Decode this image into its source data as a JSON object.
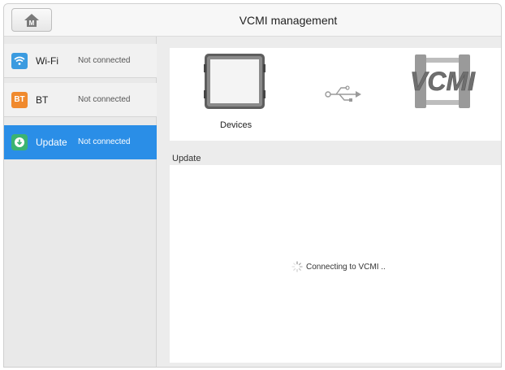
{
  "header": {
    "title": "VCMI management",
    "home_icon": "home-icon",
    "home_label": "M"
  },
  "sidebar": {
    "items": [
      {
        "icon": "wifi-icon",
        "icon_color": "#3b9be0",
        "label": "Wi-Fi",
        "status": "Not connected",
        "active": false
      },
      {
        "icon": "bt-icon",
        "icon_text": "BT",
        "icon_color": "#f08a2e",
        "label": "BT",
        "status": "Not connected",
        "active": false
      },
      {
        "icon": "download-icon",
        "icon_color": "#3cb371",
        "label": "Update",
        "status": "Not connected",
        "active": true
      }
    ]
  },
  "main": {
    "devices_label": "Devices",
    "vcmi_logo_text": "VCMI",
    "connection_icon": "usb-icon",
    "section_title": "Update",
    "status_text": "Connecting to VCMI ..",
    "status_icon": "spinner-icon"
  },
  "colors": {
    "accent": "#2a8ee7",
    "background": "#ececec"
  }
}
